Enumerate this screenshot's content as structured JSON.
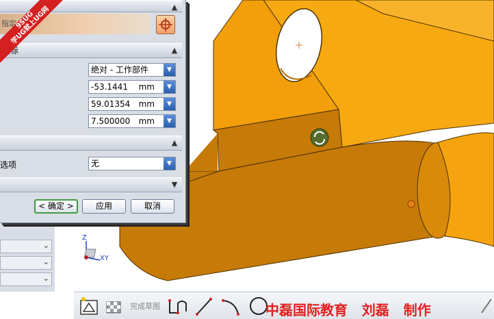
{
  "dialog": {
    "specify_point_label": "指定点",
    "coordinates_header": "坐标",
    "reference_value": "绝对 - 工作部件",
    "x_value": "-53.1441",
    "y_value": "59.01354",
    "z_value": "7.500000",
    "unit": "mm",
    "associativity_header": "",
    "options_label": "选项",
    "options_value": "无",
    "ok_label": "< 确定 >",
    "apply_label": "应用",
    "cancel_label": "取消"
  },
  "toolbar": {
    "finish_sketch_label": "完成草图"
  },
  "triad": {
    "z_label": "Z",
    "xy_label": "XY"
  },
  "watermark": {
    "text": "中磊国际教育   刘磊   制作",
    "corner_line1": "9SUG",
    "corner_line2": "学UG就上UG网"
  },
  "colors": {
    "part_light": "#f7a912",
    "part_dark": "#c67a08",
    "dialog_bg": "#d9dee6",
    "accent_blue": "#2a5fb0",
    "watermark_red": "#e02020"
  }
}
